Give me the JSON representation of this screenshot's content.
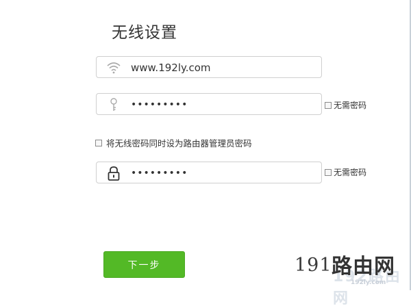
{
  "page": {
    "title": "无线设置"
  },
  "ssid_field": {
    "icon": "wifi-icon",
    "value": "www.192ly.com"
  },
  "wireless_password_field": {
    "icon": "key-icon",
    "value": "•••••••••",
    "no_password_label": "无需密码"
  },
  "sync_option": {
    "label": "将无线密码同时设为路由器管理员密码",
    "checked": false
  },
  "admin_password_field": {
    "icon": "lock-icon",
    "value": "•••••••••",
    "no_password_label": "无需密码"
  },
  "next_button": {
    "label": "下一步"
  },
  "watermark": {
    "number": "191",
    "text": "路由网",
    "text_faint": "192路由网",
    "url": "192ly.com"
  },
  "colors": {
    "accent": "#53b926",
    "border": "#cfcfcf",
    "text": "#333333"
  }
}
